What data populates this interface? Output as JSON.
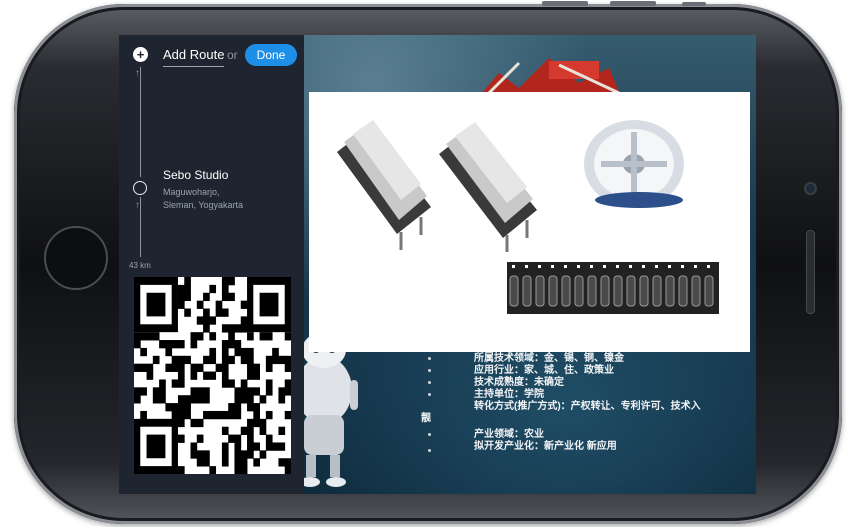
{
  "route_panel": {
    "add_route_label": "Add Route",
    "or_label": "or",
    "done_label": "Done",
    "stop": {
      "name": "Sebo Studio",
      "address_line1": "Maguwoharjo,",
      "address_line2": "Sleman, Yogyakarta"
    },
    "distance": "43 km"
  },
  "background_text": {
    "lines": [
      "所属技术领域：金、锡、铜、镍金",
      "应用行业：家、城、住、政策业",
      "技术成熟度：未确定",
      "主持单位：学院",
      "转化方式(推广方式)：产权转让、专利许可、技术入",
      "产业领域：农业",
      "拟开发产业化：新产业化 新应用"
    ],
    "side_label": "靓"
  },
  "colors": {
    "done_button": "#1e8fe6",
    "sidebar_bg": "#1e2530",
    "phone_body": "#111215"
  },
  "icons": [
    "plus-icon",
    "arrow-up-icon",
    "stop-circle-icon",
    "qr-code"
  ]
}
